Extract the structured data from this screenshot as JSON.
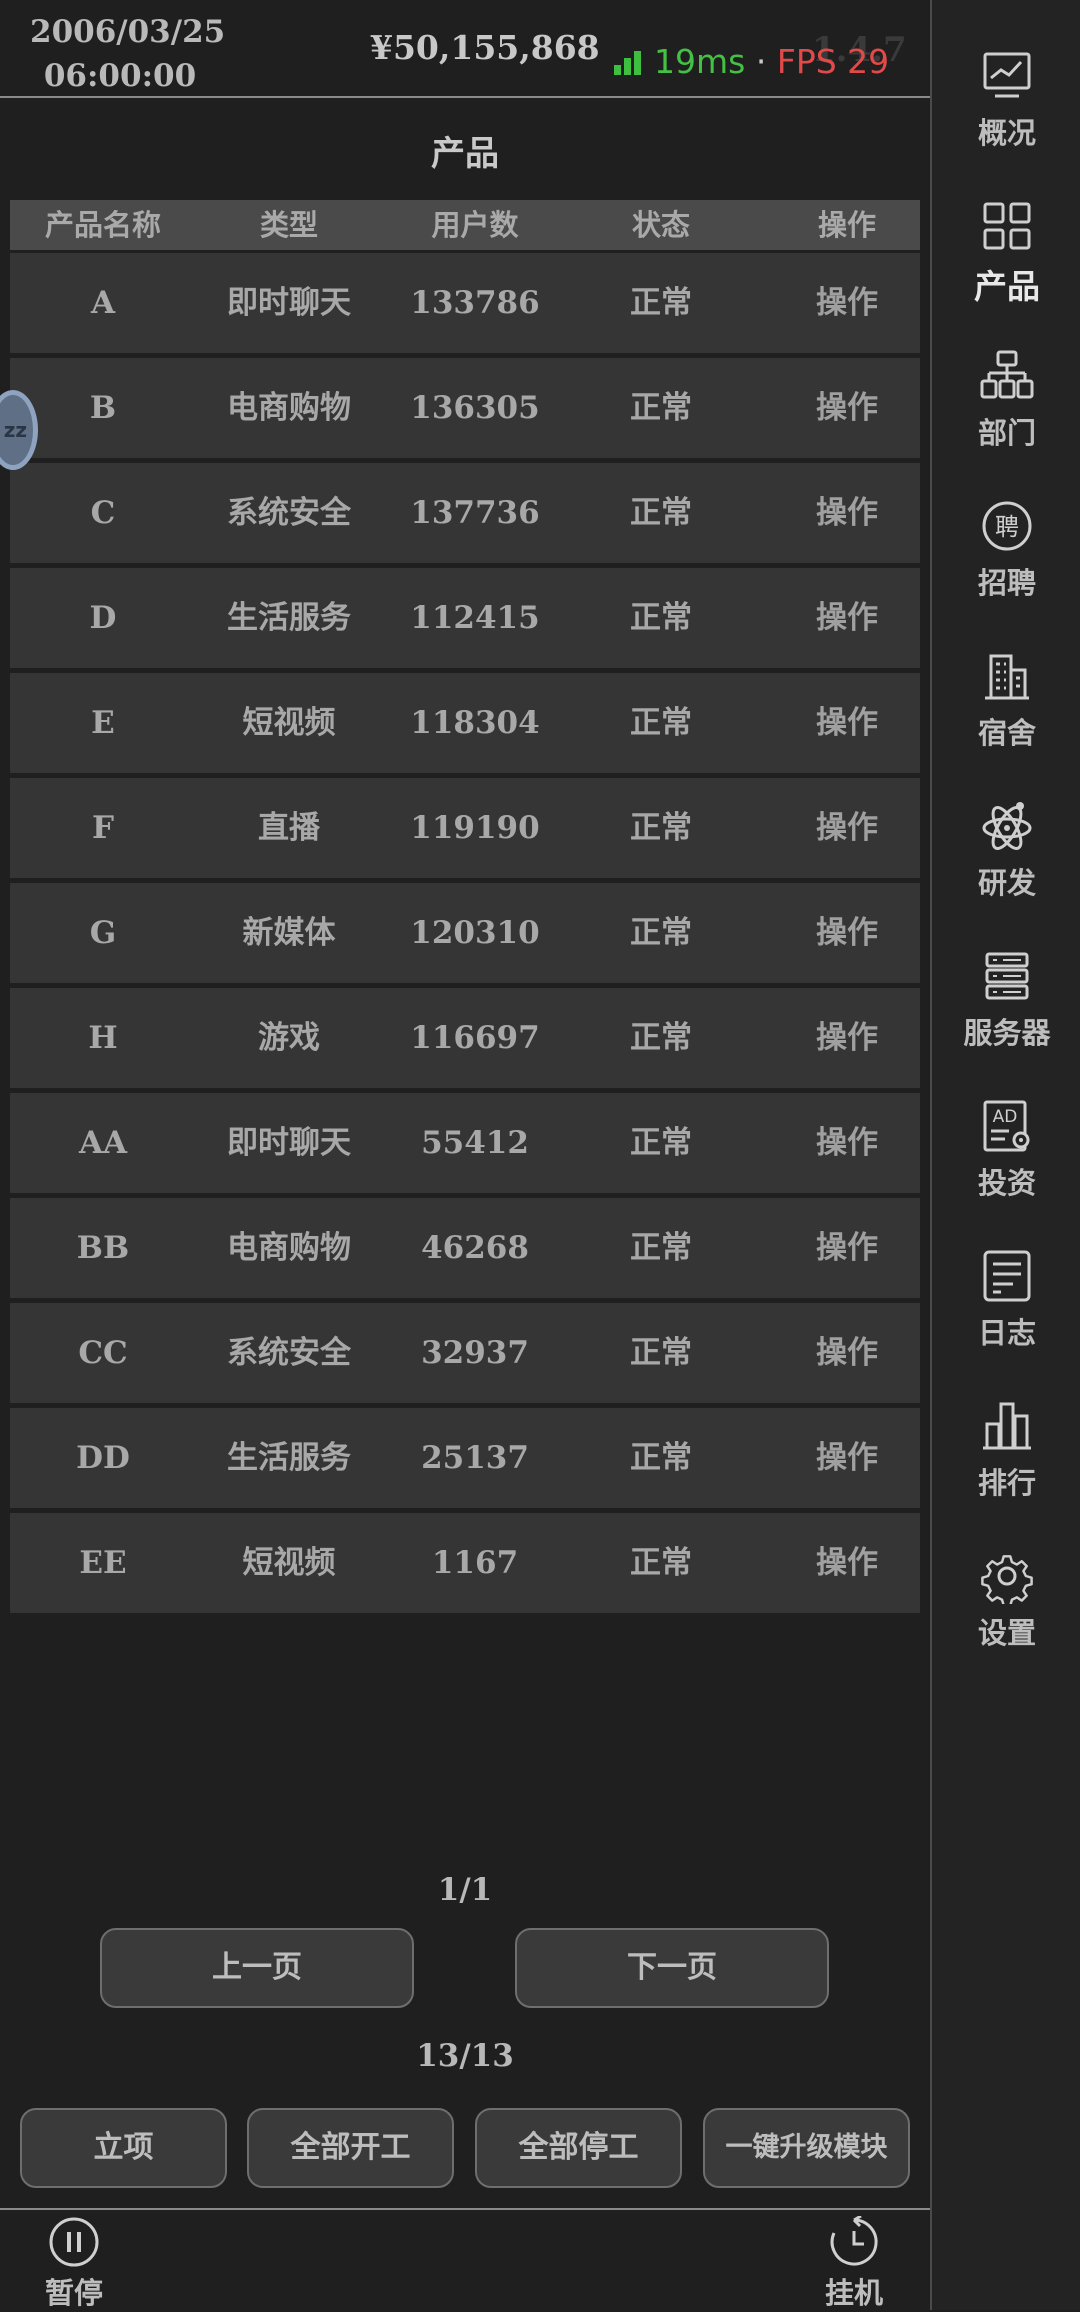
{
  "header": {
    "date": "2006/03/25",
    "time": "06:00:00",
    "money": "¥50,155,868",
    "latency": "19ms",
    "separator": "·",
    "fps": "FPS 29",
    "version": "1.4.7"
  },
  "page": {
    "title": "产品"
  },
  "table": {
    "columns": [
      "产品名称",
      "类型",
      "用户数",
      "状态",
      "操作"
    ],
    "rows": [
      {
        "name": "A",
        "type": "即时聊天",
        "users": "133786",
        "status": "正常",
        "action": "操作"
      },
      {
        "name": "B",
        "type": "电商购物",
        "users": "136305",
        "status": "正常",
        "action": "操作"
      },
      {
        "name": "C",
        "type": "系统安全",
        "users": "137736",
        "status": "正常",
        "action": "操作"
      },
      {
        "name": "D",
        "type": "生活服务",
        "users": "112415",
        "status": "正常",
        "action": "操作"
      },
      {
        "name": "E",
        "type": "短视频",
        "users": "118304",
        "status": "正常",
        "action": "操作"
      },
      {
        "name": "F",
        "type": "直播",
        "users": "119190",
        "status": "正常",
        "action": "操作"
      },
      {
        "name": "G",
        "type": "新媒体",
        "users": "120310",
        "status": "正常",
        "action": "操作"
      },
      {
        "name": "H",
        "type": "游戏",
        "users": "116697",
        "status": "正常",
        "action": "操作"
      },
      {
        "name": "AA",
        "type": "即时聊天",
        "users": "55412",
        "status": "正常",
        "action": "操作"
      },
      {
        "name": "BB",
        "type": "电商购物",
        "users": "46268",
        "status": "正常",
        "action": "操作"
      },
      {
        "name": "CC",
        "type": "系统安全",
        "users": "32937",
        "status": "正常",
        "action": "操作"
      },
      {
        "name": "DD",
        "type": "生活服务",
        "users": "25137",
        "status": "正常",
        "action": "操作"
      },
      {
        "name": "EE",
        "type": "短视频",
        "users": "1167",
        "status": "正常",
        "action": "操作"
      }
    ]
  },
  "bubble": {
    "text": "zz"
  },
  "pagination": {
    "page": "1/1",
    "prev": "上一页",
    "next": "下一页",
    "count": "13/13"
  },
  "actions": [
    "立项",
    "全部开工",
    "全部停工",
    "一键升级模块"
  ],
  "bottom": {
    "pause": "暂停",
    "idle": "挂机"
  },
  "sidebar": {
    "items": [
      {
        "label": "概况",
        "icon": "chart-monitor-icon"
      },
      {
        "label": "产品",
        "icon": "grid-icon",
        "active": true
      },
      {
        "label": "部门",
        "icon": "org-chart-icon"
      },
      {
        "label": "招聘",
        "icon": "recruit-icon",
        "glyph": "聘"
      },
      {
        "label": "宿舍",
        "icon": "building-icon"
      },
      {
        "label": "研发",
        "icon": "atom-icon"
      },
      {
        "label": "服务器",
        "icon": "server-icon"
      },
      {
        "label": "投资",
        "icon": "ad-icon",
        "glyph": "AD"
      },
      {
        "label": "日志",
        "icon": "log-icon"
      },
      {
        "label": "排行",
        "icon": "ranking-icon"
      },
      {
        "label": "设置",
        "icon": "gear-icon"
      }
    ]
  },
  "colors": {
    "latency": "#44c044",
    "fps": "#e24a4a",
    "background": "#1f1f1f",
    "row": "#353535"
  }
}
